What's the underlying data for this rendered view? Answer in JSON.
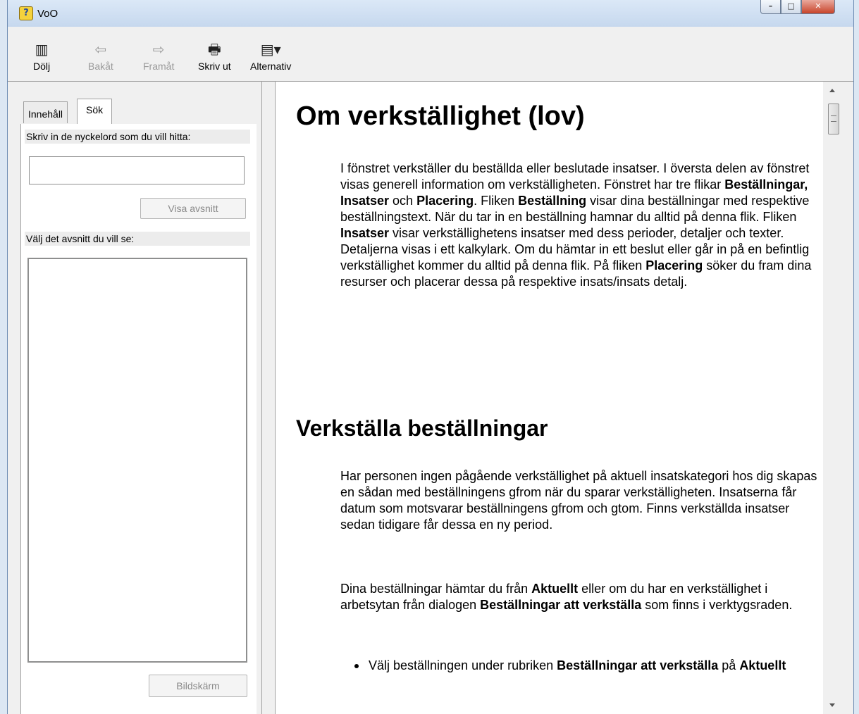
{
  "window": {
    "title": "VoO",
    "icon": "help-question-icon"
  },
  "toolbar": {
    "hide": {
      "label": "Dölj",
      "icon": "hide-pane-icon"
    },
    "back": {
      "label": "Bakåt",
      "icon": "arrow-left-icon"
    },
    "forward": {
      "label": "Framåt",
      "icon": "arrow-right-icon"
    },
    "print": {
      "label": "Skriv ut",
      "icon": "printer-icon"
    },
    "options": {
      "label": "Alternativ",
      "icon": "options-icon"
    }
  },
  "left": {
    "tabs": {
      "contents": "Innehåll",
      "search": "Sök"
    },
    "keyword_label": "Skriv in de nyckelord som du vill hitta:",
    "keyword_value": "",
    "show_button": "Visa avsnitt",
    "select_label": "Välj det avsnitt du vill se:",
    "display_button": "Bildskärm"
  },
  "content": {
    "h1": "Om verkställighet (lov)",
    "p1": [
      {
        "t": "I fönstret verkställer du beställda  eller beslutade insatser. I översta delen av fönstret visas generell information om verkställigheten. Fönstret har tre flikar "
      },
      {
        "b": "Beställningar, Insatser"
      },
      {
        "t": " och "
      },
      {
        "b": "Placering"
      },
      {
        "t": ". Fliken "
      },
      {
        "b": "Beställning"
      },
      {
        "t": " visar dina beställningar med respektive beställningstext. När du tar in en beställning hamnar du alltid på denna flik. Fliken "
      },
      {
        "b": "Insatser"
      },
      {
        "t": " visar verkställighetens insatser med dess perioder, detaljer och texter. Detaljerna visas i ett kalkylark. Om du hämtar in ett beslut eller går in på en befintlig verkställighet kommer du alltid på denna flik. På fliken "
      },
      {
        "b": "Placering"
      },
      {
        "t": " söker du fram dina resurser och placerar dessa på respektive insats/insats detalj."
      }
    ],
    "h2": "Verkställa beställningar",
    "p2": "Har personen ingen pågående verkställighet på aktuell insatskategori hos dig skapas en sådan med beställningens gfrom när du sparar verkställigheten. Insatserna får datum som motsvarar beställningens gfrom och gtom. Finns verkställda insatser sedan tidigare får dessa en ny period.",
    "p3": [
      {
        "t": "Dina beställningar hämtar du från "
      },
      {
        "b": "Aktuellt"
      },
      {
        "t": " eller om du har en verkställighet i arbetsytan från dialogen "
      },
      {
        "b": "Beställningar att verkställa"
      },
      {
        "t": " som finns i verktygsraden."
      }
    ],
    "bullet1": [
      {
        "t": "Välj beställningen under rubriken "
      },
      {
        "b": "Beställningar att verkställa"
      },
      {
        "t": " på "
      },
      {
        "b": "Aktuellt"
      }
    ]
  }
}
